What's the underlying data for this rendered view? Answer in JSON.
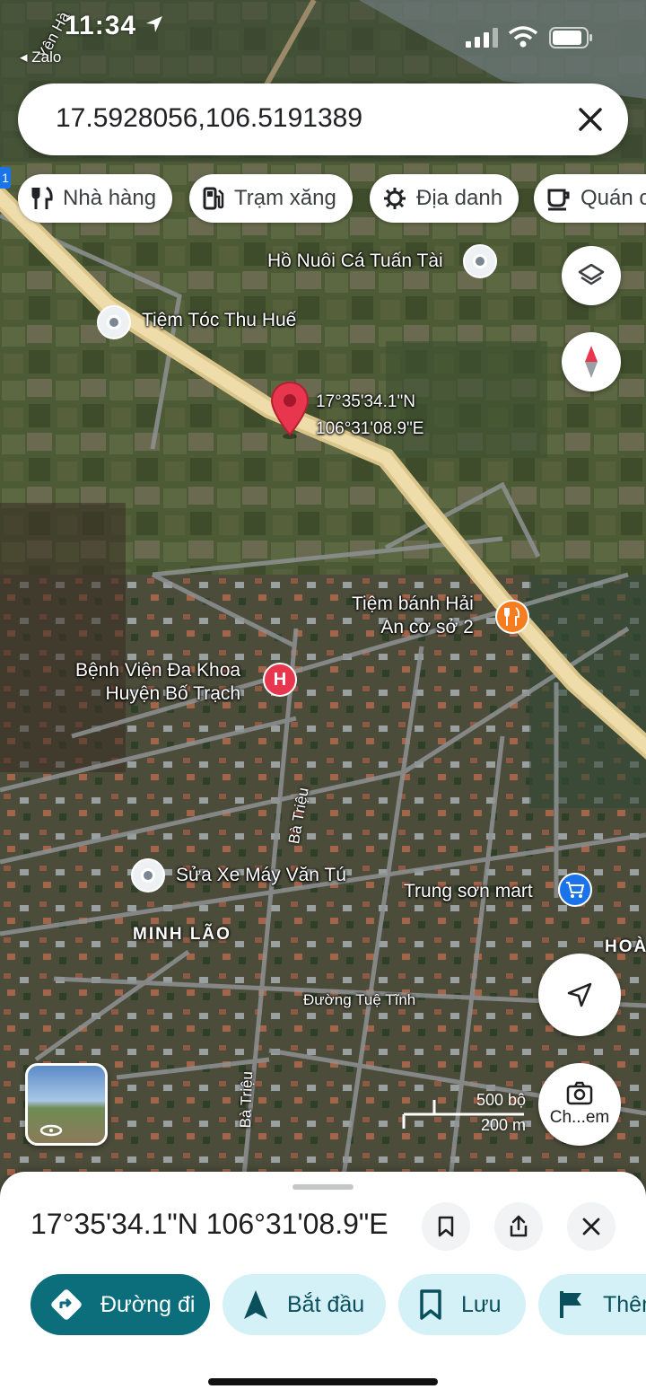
{
  "status": {
    "time": "11:34",
    "back_app": "◂ Zalo"
  },
  "search": {
    "query": "17.5928056,106.5191389"
  },
  "chips": [
    {
      "label": "Nhà hàng",
      "icon": "fork-knife-icon"
    },
    {
      "label": "Trạm xăng",
      "icon": "gas-station-icon"
    },
    {
      "label": "Địa danh",
      "icon": "landmark-icon"
    },
    {
      "label": "Quán c",
      "icon": "coffee-icon"
    }
  ],
  "map": {
    "pin": {
      "lat_label": "17°35'34.1\"N",
      "lng_label": "106°31'08.9\"E"
    },
    "places": {
      "ho_nuoi_ca": "Hồ Nuôi Cá Tuấn Tài",
      "tiem_toc": "Tiệm Tóc Thu Huế",
      "tiem_banh_1": "Tiệm bánh Hải",
      "tiem_banh_2": "An cơ sở 2",
      "benh_vien_1": "Bệnh Viện Đa Khoa",
      "benh_vien_2": "Huyện Bố Trạch",
      "sua_xe": "Sửa Xe Máy Văn Tú",
      "trung_son": "Trung sơn mart"
    },
    "areas": {
      "minh_lao": "MINH LÃO",
      "hoai": "HOÀI"
    },
    "streets": {
      "ba_trieu_1": "Bà Triệu",
      "ba_trieu_2": "Bà Triệu",
      "tue_tinh": "Đường Tuệ Tĩnh",
      "yen_ha": "Yên Hà"
    },
    "scale": {
      "imperial": "500 bộ",
      "metric": "200 m"
    },
    "camera_button_label": "Ch...em",
    "route_marker": "1"
  },
  "sheet": {
    "title": "17°35'34.1\"N 106°31'08.9\"E",
    "actions": [
      {
        "label": "Đường đi",
        "icon": "directions-icon"
      },
      {
        "label": "Bắt đầu",
        "icon": "navigation-arrow-icon"
      },
      {
        "label": "Lưu",
        "icon": "bookmark-icon"
      },
      {
        "label": "Thêm",
        "icon": "flag-icon"
      }
    ]
  },
  "colors": {
    "primary": "#0b6e7a",
    "secondary": "#d4f1f7",
    "pin": "#e8364f",
    "road": "#e9d7a0"
  }
}
